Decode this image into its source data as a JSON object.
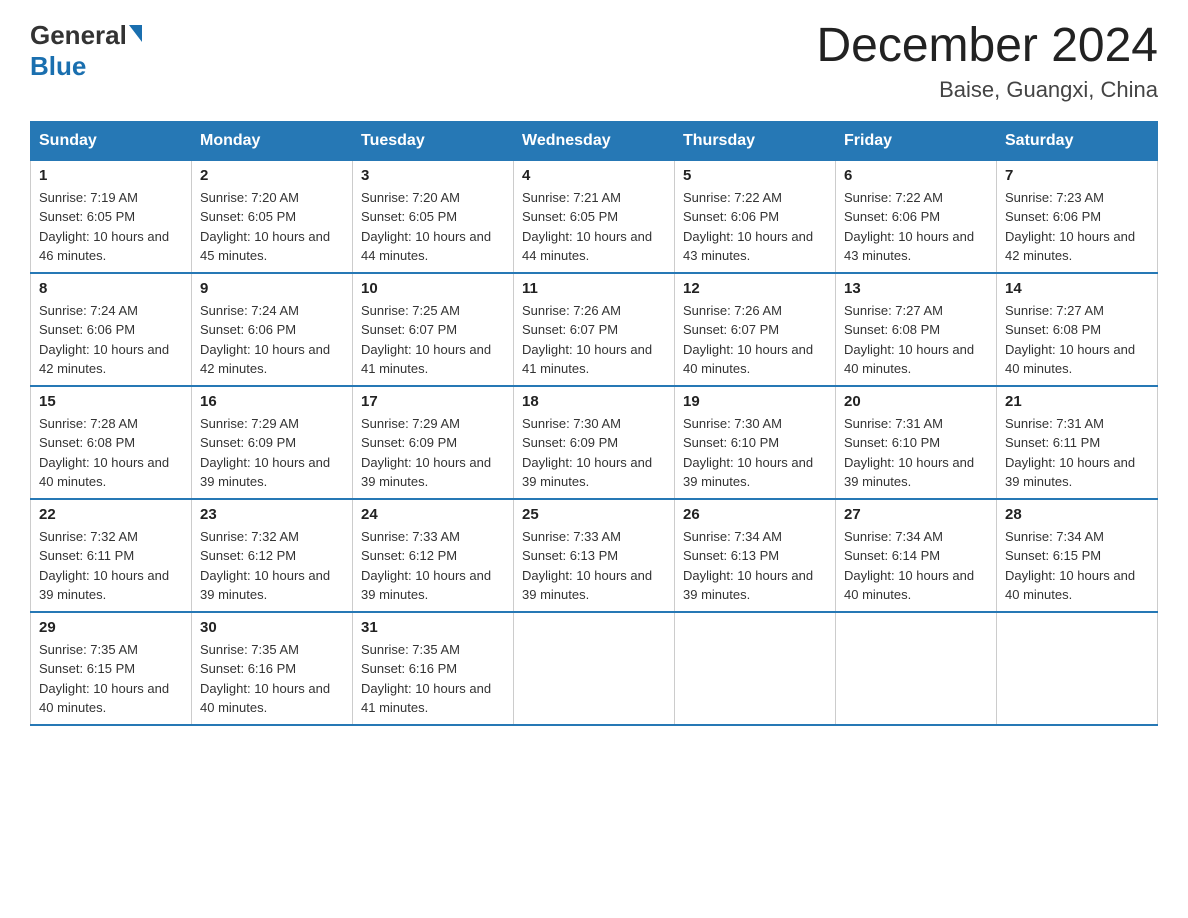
{
  "header": {
    "logo_general": "General",
    "logo_blue": "Blue",
    "month_year": "December 2024",
    "location": "Baise, Guangxi, China"
  },
  "days_of_week": [
    "Sunday",
    "Monday",
    "Tuesday",
    "Wednesday",
    "Thursday",
    "Friday",
    "Saturday"
  ],
  "weeks": [
    [
      {
        "day": "1",
        "sunrise": "7:19 AM",
        "sunset": "6:05 PM",
        "daylight": "10 hours and 46 minutes."
      },
      {
        "day": "2",
        "sunrise": "7:20 AM",
        "sunset": "6:05 PM",
        "daylight": "10 hours and 45 minutes."
      },
      {
        "day": "3",
        "sunrise": "7:20 AM",
        "sunset": "6:05 PM",
        "daylight": "10 hours and 44 minutes."
      },
      {
        "day": "4",
        "sunrise": "7:21 AM",
        "sunset": "6:05 PM",
        "daylight": "10 hours and 44 minutes."
      },
      {
        "day": "5",
        "sunrise": "7:22 AM",
        "sunset": "6:06 PM",
        "daylight": "10 hours and 43 minutes."
      },
      {
        "day": "6",
        "sunrise": "7:22 AM",
        "sunset": "6:06 PM",
        "daylight": "10 hours and 43 minutes."
      },
      {
        "day": "7",
        "sunrise": "7:23 AM",
        "sunset": "6:06 PM",
        "daylight": "10 hours and 42 minutes."
      }
    ],
    [
      {
        "day": "8",
        "sunrise": "7:24 AM",
        "sunset": "6:06 PM",
        "daylight": "10 hours and 42 minutes."
      },
      {
        "day": "9",
        "sunrise": "7:24 AM",
        "sunset": "6:06 PM",
        "daylight": "10 hours and 42 minutes."
      },
      {
        "day": "10",
        "sunrise": "7:25 AM",
        "sunset": "6:07 PM",
        "daylight": "10 hours and 41 minutes."
      },
      {
        "day": "11",
        "sunrise": "7:26 AM",
        "sunset": "6:07 PM",
        "daylight": "10 hours and 41 minutes."
      },
      {
        "day": "12",
        "sunrise": "7:26 AM",
        "sunset": "6:07 PM",
        "daylight": "10 hours and 40 minutes."
      },
      {
        "day": "13",
        "sunrise": "7:27 AM",
        "sunset": "6:08 PM",
        "daylight": "10 hours and 40 minutes."
      },
      {
        "day": "14",
        "sunrise": "7:27 AM",
        "sunset": "6:08 PM",
        "daylight": "10 hours and 40 minutes."
      }
    ],
    [
      {
        "day": "15",
        "sunrise": "7:28 AM",
        "sunset": "6:08 PM",
        "daylight": "10 hours and 40 minutes."
      },
      {
        "day": "16",
        "sunrise": "7:29 AM",
        "sunset": "6:09 PM",
        "daylight": "10 hours and 39 minutes."
      },
      {
        "day": "17",
        "sunrise": "7:29 AM",
        "sunset": "6:09 PM",
        "daylight": "10 hours and 39 minutes."
      },
      {
        "day": "18",
        "sunrise": "7:30 AM",
        "sunset": "6:09 PM",
        "daylight": "10 hours and 39 minutes."
      },
      {
        "day": "19",
        "sunrise": "7:30 AM",
        "sunset": "6:10 PM",
        "daylight": "10 hours and 39 minutes."
      },
      {
        "day": "20",
        "sunrise": "7:31 AM",
        "sunset": "6:10 PM",
        "daylight": "10 hours and 39 minutes."
      },
      {
        "day": "21",
        "sunrise": "7:31 AM",
        "sunset": "6:11 PM",
        "daylight": "10 hours and 39 minutes."
      }
    ],
    [
      {
        "day": "22",
        "sunrise": "7:32 AM",
        "sunset": "6:11 PM",
        "daylight": "10 hours and 39 minutes."
      },
      {
        "day": "23",
        "sunrise": "7:32 AM",
        "sunset": "6:12 PM",
        "daylight": "10 hours and 39 minutes."
      },
      {
        "day": "24",
        "sunrise": "7:33 AM",
        "sunset": "6:12 PM",
        "daylight": "10 hours and 39 minutes."
      },
      {
        "day": "25",
        "sunrise": "7:33 AM",
        "sunset": "6:13 PM",
        "daylight": "10 hours and 39 minutes."
      },
      {
        "day": "26",
        "sunrise": "7:34 AM",
        "sunset": "6:13 PM",
        "daylight": "10 hours and 39 minutes."
      },
      {
        "day": "27",
        "sunrise": "7:34 AM",
        "sunset": "6:14 PM",
        "daylight": "10 hours and 40 minutes."
      },
      {
        "day": "28",
        "sunrise": "7:34 AM",
        "sunset": "6:15 PM",
        "daylight": "10 hours and 40 minutes."
      }
    ],
    [
      {
        "day": "29",
        "sunrise": "7:35 AM",
        "sunset": "6:15 PM",
        "daylight": "10 hours and 40 minutes."
      },
      {
        "day": "30",
        "sunrise": "7:35 AM",
        "sunset": "6:16 PM",
        "daylight": "10 hours and 40 minutes."
      },
      {
        "day": "31",
        "sunrise": "7:35 AM",
        "sunset": "6:16 PM",
        "daylight": "10 hours and 41 minutes."
      },
      null,
      null,
      null,
      null
    ]
  ],
  "labels": {
    "sunrise": "Sunrise:",
    "sunset": "Sunset:",
    "daylight": "Daylight:"
  }
}
